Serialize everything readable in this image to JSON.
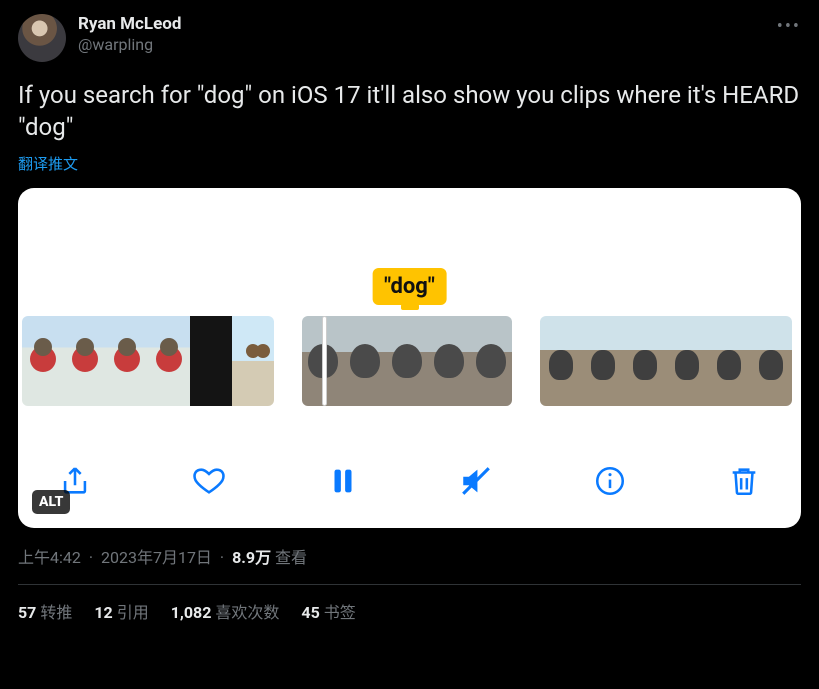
{
  "header": {
    "display_name": "Ryan McLeod",
    "handle": "@warpling"
  },
  "tweet": {
    "text": "If you search for \"dog\" on iOS 17 it'll also show you clips where it's HEARD \"dog\"",
    "translate_label": "翻译推文"
  },
  "media": {
    "caption": "\"dog\"",
    "alt_badge": "ALT"
  },
  "meta": {
    "time": "上午4:42",
    "date": "2023年7月17日",
    "views_number": "8.9万",
    "views_label": "查看"
  },
  "stats": {
    "retweets": {
      "count": "57",
      "label": "转推"
    },
    "quotes": {
      "count": "12",
      "label": "引用"
    },
    "likes": {
      "count": "1,082",
      "label": "喜欢次数"
    },
    "bookmarks": {
      "count": "45",
      "label": "书签"
    }
  }
}
